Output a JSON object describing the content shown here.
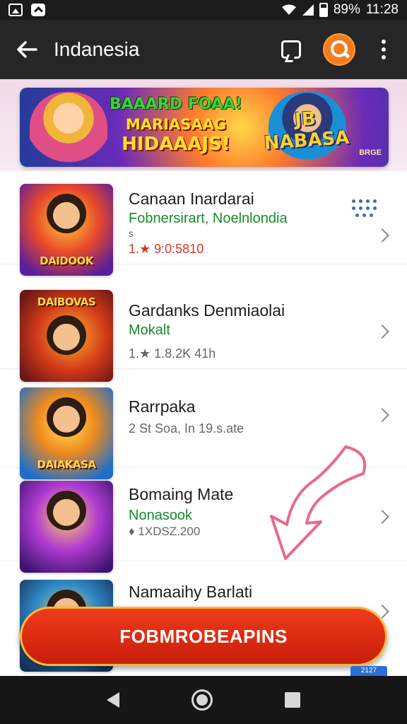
{
  "status_bar": {
    "battery": "89%",
    "time": "11:28"
  },
  "app_bar": {
    "title": "Indanesia"
  },
  "banner": {
    "left_text": [
      "BAAARD FOAA!",
      "MARIASAAG",
      "HIDAAAJS!"
    ],
    "right_text": "JB NABASA",
    "badge": "BRGE"
  },
  "list": [
    {
      "title": "Canaan Inardarai",
      "subtitle": "Fobnersirart, Noelnlondia",
      "extra": "s",
      "meta": "1.★ 9:0:5810",
      "thumb_caption": "DAIDOOK"
    },
    {
      "title": "Gardanks Denmiaolai",
      "subtitle": "Mokalt",
      "meta": "1.★ 1.8.2K 41h",
      "thumb_caption": "DAIBOVAS"
    },
    {
      "title": "Rarrpaka",
      "subtitle": "",
      "meta": "2 St Soa, In 19.s.ate",
      "thumb_caption": "DAIAKASA"
    },
    {
      "title": "Bomaing Mate",
      "subtitle": "Nonasook",
      "meta": "♦ 1XDSZ.200",
      "thumb_caption": ""
    },
    {
      "title": "Namaaihy Barlati",
      "subtitle": "",
      "meta": "",
      "thumb_caption": ""
    }
  ],
  "cta": {
    "label": "FOBMROBEAPINS"
  },
  "tag_bottom": "2127",
  "colors": {
    "accent_orange": "#f27c1e",
    "cta_red": "#e0301a",
    "subtitle_green": "#1a8a2a"
  }
}
